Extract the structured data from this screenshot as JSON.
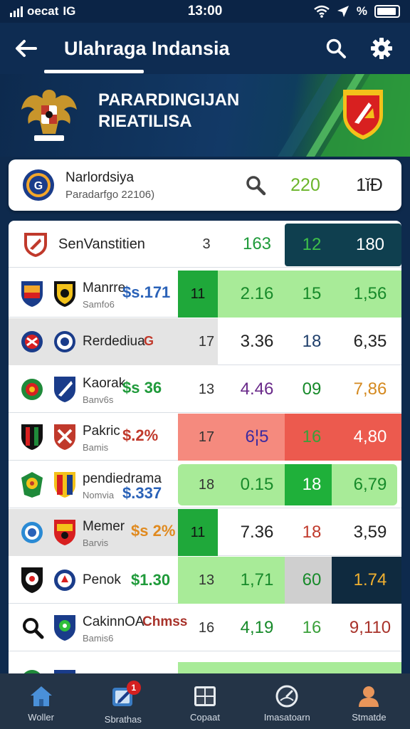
{
  "status": {
    "carrier": "oecat",
    "network": "IG",
    "time": "13:00",
    "battery_label": "%"
  },
  "app_bar": {
    "title": "Ulahraga Indansia"
  },
  "banner": {
    "title_line1": "PARARDINGIJAN",
    "title_line2": "RIEATILISA"
  },
  "summary": {
    "name": "Narlordsiya",
    "sub": "Paradarfgo 22106)",
    "value1": "220",
    "value2": "1ǐƉ"
  },
  "table_header": {
    "team": "SenVanstitien",
    "rank": "3",
    "a": "163",
    "b": "12",
    "c": "180"
  },
  "rows": [
    {
      "name": "Manrre",
      "sub": "Samfo6",
      "price": "$s.171",
      "price_color": "#2a62b8",
      "rank": "11",
      "a": "2.16",
      "b": "15",
      "c": "1,56",
      "a_color": "#178a2a",
      "b_color": "#178a2a",
      "c_color": "#178a2a"
    },
    {
      "name": "Rerdediua",
      "sub": "",
      "price": "G",
      "price_color": "#c0392b",
      "rank": "17",
      "a": "3.36",
      "b": "18",
      "c": "6,35",
      "a_color": "#222222",
      "b_color": "#1f3f6b",
      "c_color": "#222222"
    },
    {
      "name": "Kaorak",
      "sub": "Banv6s",
      "price": "$s 36",
      "price_color": "#1f9a3a",
      "rank": "13",
      "a": "4.46",
      "b": "09",
      "c": "7,86",
      "a_color": "#6a2a8a",
      "b_color": "#178a2a",
      "c_color": "#d4891f"
    },
    {
      "name": "Pakric",
      "sub": "Bamis",
      "price": "$.2%",
      "price_color": "#c0392b",
      "rank": "17",
      "a": "6¦5",
      "b": "16",
      "c": "4,80",
      "a_color": "#3a2aa0",
      "b_color": "#3aa03a",
      "c_color": "#ffffff"
    },
    {
      "name": "pendiedrama",
      "sub": "Nomvia",
      "price": "$.337",
      "price_color": "#2a62b8",
      "rank": "18",
      "a": "0.15",
      "b": "18",
      "c": "6,79",
      "a_color": "#178a2a",
      "b_color": "#ffffff",
      "c_color": "#178a2a"
    },
    {
      "name": "Memer",
      "sub": "Barvis",
      "price": "$s 2%",
      "price_color": "#e08a1f",
      "rank": "11",
      "a": "7.36",
      "b": "18",
      "c": "3,59",
      "a_color": "#222222",
      "b_color": "#c0392b",
      "c_color": "#222222"
    },
    {
      "name": "Penok",
      "sub": "",
      "price": "$1.30",
      "price_color": "#1f9a3a",
      "rank": "13",
      "a": "1,71",
      "b": "60",
      "c": "1.74",
      "a_color": "#178a2a",
      "b_color": "#178a2a",
      "c_color": "#f0b030"
    },
    {
      "name": "CakinnOA",
      "sub": "Bamis6",
      "price": "Chmss",
      "price_color": "#a8322a",
      "rank": "16",
      "a": "4,19",
      "b": "16",
      "c": "9,110",
      "a_color": "#178a2a",
      "b_color": "#3aa03a",
      "c_color": "#a8322a"
    }
  ],
  "nav": [
    {
      "label": "Woller",
      "icon": "home-icon"
    },
    {
      "label": "Sbrathas",
      "icon": "edit-icon",
      "badge": "1"
    },
    {
      "label": "Copaat",
      "icon": "grid-icon"
    },
    {
      "label": "Imasatoarn",
      "icon": "gauge-icon"
    },
    {
      "label": "Stmatde",
      "icon": "profile-icon"
    }
  ],
  "colors": {
    "app_bar": "#0e2c52",
    "accent_green": "#2fbf3a",
    "light_green": "#a9e89a",
    "highlight_red": "#f27a6e",
    "dark_navy": "#0f2a3f"
  }
}
